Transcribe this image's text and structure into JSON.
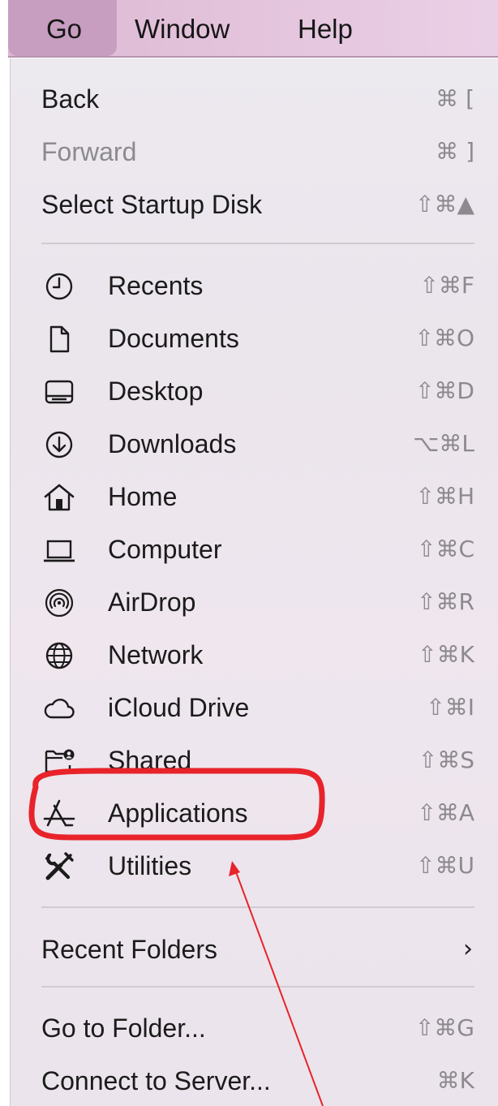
{
  "menubar": {
    "go": "Go",
    "window": "Window",
    "help": "Help"
  },
  "menu": {
    "back": {
      "label": "Back",
      "shortcut": "⌘ ["
    },
    "forward": {
      "label": "Forward",
      "shortcut": "⌘ ]"
    },
    "startup": {
      "label": "Select Startup Disk",
      "shortcut": "⇧⌘▲"
    },
    "recents": {
      "label": "Recents",
      "shortcut": "⇧⌘F",
      "icon": "clock-icon"
    },
    "documents": {
      "label": "Documents",
      "shortcut": "⇧⌘O",
      "icon": "document-icon"
    },
    "desktop": {
      "label": "Desktop",
      "shortcut": "⇧⌘D",
      "icon": "desktop-icon"
    },
    "downloads": {
      "label": "Downloads",
      "shortcut": "⌥⌘L",
      "icon": "download-icon"
    },
    "home": {
      "label": "Home",
      "shortcut": "⇧⌘H",
      "icon": "home-icon"
    },
    "computer": {
      "label": "Computer",
      "shortcut": "⇧⌘C",
      "icon": "laptop-icon"
    },
    "airdrop": {
      "label": "AirDrop",
      "shortcut": "⇧⌘R",
      "icon": "airdrop-icon"
    },
    "network": {
      "label": "Network",
      "shortcut": "⇧⌘K",
      "icon": "globe-icon"
    },
    "icloud": {
      "label": "iCloud Drive",
      "shortcut": "⇧⌘I",
      "icon": "cloud-icon"
    },
    "shared": {
      "label": "Shared",
      "shortcut": "⇧⌘S",
      "icon": "shared-folder-icon"
    },
    "applications": {
      "label": "Applications",
      "shortcut": "⇧⌘A",
      "icon": "applications-icon"
    },
    "utilities": {
      "label": "Utilities",
      "shortcut": "⇧⌘U",
      "icon": "utilities-icon"
    },
    "recent_folders": {
      "label": "Recent Folders",
      "shortcut": "›"
    },
    "go_to_folder": {
      "label": "Go to Folder...",
      "shortcut": "⇧⌘G"
    },
    "connect_server": {
      "label": "Connect to Server...",
      "shortcut": "⌘K"
    }
  },
  "annotation": {
    "highlight_color": "#e8232a",
    "arrow_color": "#e8232a"
  }
}
